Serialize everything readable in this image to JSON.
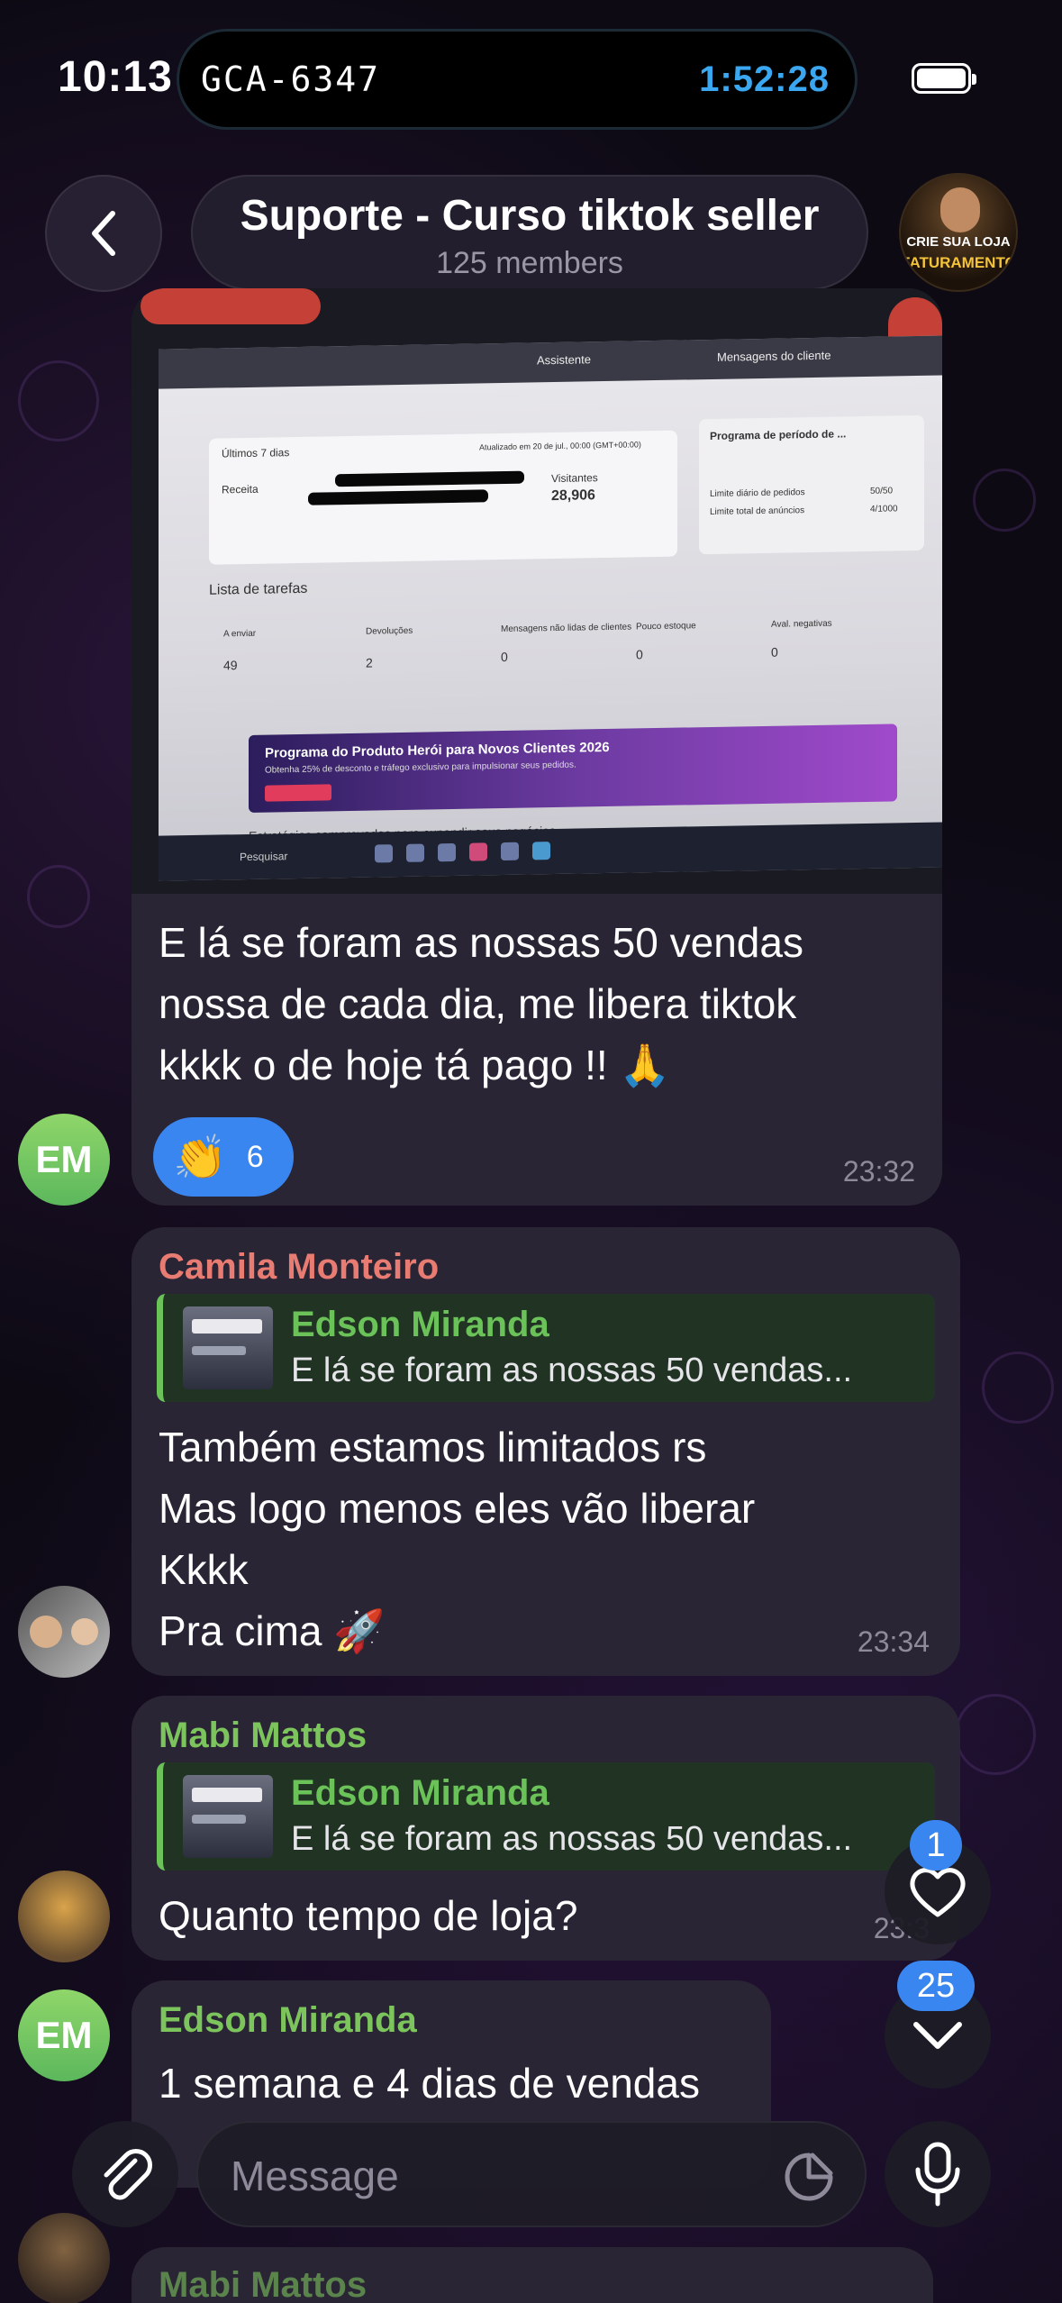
{
  "status_bar": {
    "time": "10:13",
    "island_label": "GCA-6347",
    "island_timer": "1:52:28"
  },
  "header": {
    "title": "Suporte - Curso tiktok seller",
    "subtitle": "125 members",
    "avatar_line1": "CRIE SUA LOJA",
    "avatar_line2": "FATURAMENTO"
  },
  "messages": [
    {
      "author_avatar": "EM",
      "text_lines": [
        "E lá se foram as nossas 50 vendas",
        "nossa de cada dia, me libera tiktok",
        "kkkk o de hoje tá pago !! 🙏"
      ],
      "reaction_emoji": "👏",
      "reaction_count": "6",
      "time": "23:32",
      "photo": {
        "topbar_items": [
          "Assistente",
          "Mensagens do cliente"
        ],
        "period": "Últimos 7 dias",
        "updated": "Atualizado em 20 de jul., 00:00 (GMT+00:00)",
        "visitors_label": "Visitantes",
        "visitors_value": "28,906",
        "receita_label": "Receita",
        "side_title": "Programa de período de ...",
        "side_row1": "Limite diário de pedidos",
        "side_row1_val": "50/50",
        "side_row2": "Limite total de anúncios",
        "side_row2_val": "4/1000",
        "tasks_title": "Lista de tarefas",
        "task_a_label": "A enviar",
        "task_a_val": "49",
        "task_b_label": "Devoluções",
        "task_b_val": "2",
        "task_c_label": "Mensagens não lidas de clientes",
        "task_c_val": "0",
        "task_d_label": "Pouco estoque",
        "task_d_val": "0",
        "task_e_label": "Aval. negativas",
        "task_e_val": "0",
        "banner_title": "Programa do Produto Herói para Novos Clientes 2026",
        "banner_sub": "Obtenha 25% de desconto e tráfego exclusivo para impulsionar seus pedidos.",
        "footer_title": "Estratégias comprovadas para expandir seus negócios",
        "search_label": "Pesquisar"
      }
    },
    {
      "sender": "Camila Monteiro",
      "reply_name": "Edson Miranda",
      "reply_text": "E lá se foram as nossas 50 vendas...",
      "text_lines": [
        "Também estamos limitados rs",
        "Mas logo menos eles vão liberar",
        "Kkkk",
        "Pra cima 🚀"
      ],
      "time": "23:34"
    },
    {
      "sender": "Mabi Mattos",
      "reply_name": "Edson Miranda",
      "reply_text": "E lá se foram as nossas 50 vendas...",
      "text": "Quanto tempo de loja?",
      "time": "23:3"
    },
    {
      "sender": "Edson Miranda",
      "author_avatar": "EM",
      "text": "1 semana e 4 dias de vendas"
    },
    {
      "sender": "Mabi Mattos"
    }
  ],
  "floating": {
    "reactions_badge": "1",
    "scroll_badge": "25"
  },
  "composer": {
    "placeholder": "Message"
  },
  "colors": {
    "accent": "#3a86f0",
    "sender_red": "#e87c72",
    "sender_green": "#7cc45c"
  }
}
